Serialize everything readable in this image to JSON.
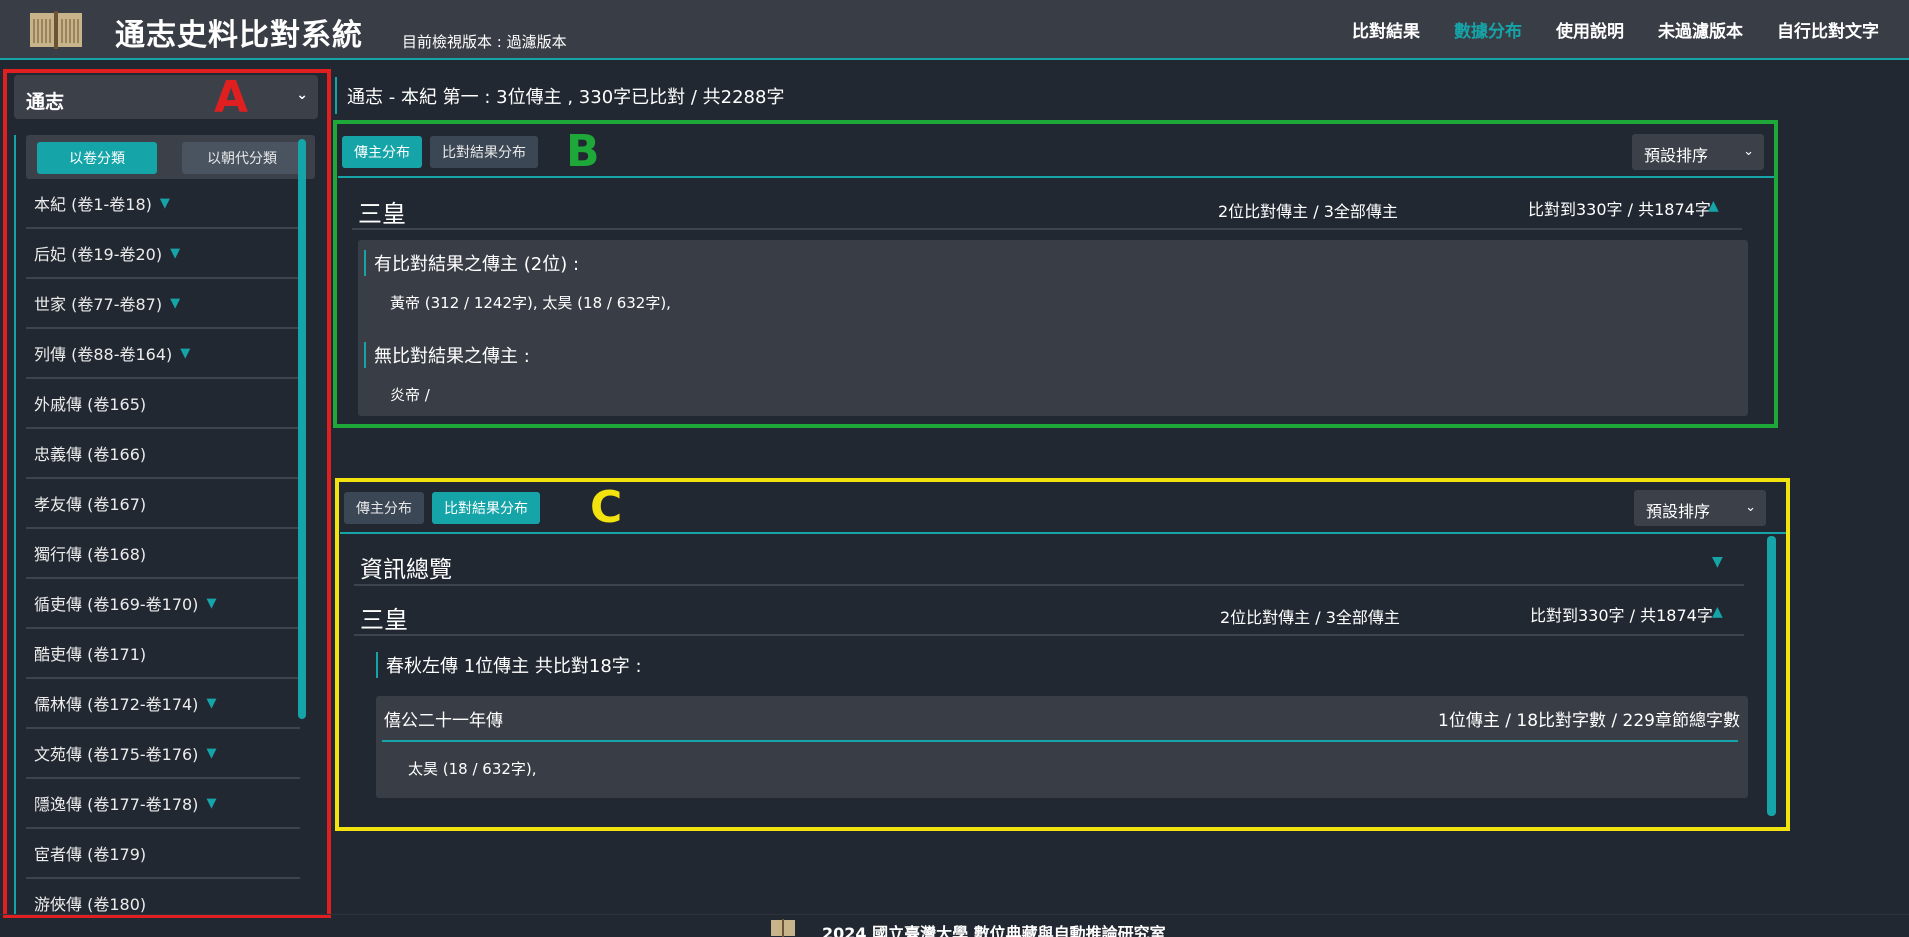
{
  "header": {
    "title": "通志史料比對系統",
    "version_label": "目前檢視版本 : 過濾版本",
    "nav": [
      {
        "label": "比對結果",
        "active": false
      },
      {
        "label": "數據分布",
        "active": true
      },
      {
        "label": "使用說明",
        "active": false
      },
      {
        "label": "未過濾版本",
        "active": false
      },
      {
        "label": "自行比對文字",
        "active": false
      }
    ]
  },
  "sidebar": {
    "book_select": "通志",
    "tabs": [
      {
        "label": "以卷分類",
        "active": true
      },
      {
        "label": "以朝代分類",
        "active": false
      }
    ],
    "chapters": [
      {
        "label": "本紀 (卷1-卷18)",
        "expandable": true
      },
      {
        "label": "后妃 (卷19-卷20)",
        "expandable": true
      },
      {
        "label": "世家 (卷77-卷87)",
        "expandable": true
      },
      {
        "label": "列傳 (卷88-卷164)",
        "expandable": true
      },
      {
        "label": "外戚傳 (卷165)",
        "expandable": false
      },
      {
        "label": "忠義傳 (卷166)",
        "expandable": false
      },
      {
        "label": "孝友傳 (卷167)",
        "expandable": false
      },
      {
        "label": "獨行傳 (卷168)",
        "expandable": false
      },
      {
        "label": "循吏傳 (卷169-卷170)",
        "expandable": true
      },
      {
        "label": "酷吏傳 (卷171)",
        "expandable": false
      },
      {
        "label": "儒林傳 (卷172-卷174)",
        "expandable": true
      },
      {
        "label": "文苑傳 (卷175-卷176)",
        "expandable": true
      },
      {
        "label": "隱逸傳 (卷177-卷178)",
        "expandable": true
      },
      {
        "label": "宦者傳 (卷179)",
        "expandable": false
      },
      {
        "label": "游俠傳 (卷180)",
        "expandable": false
      }
    ]
  },
  "breadcrumb": "通志 - 本紀 第一 :   3位傳主 , 330字已比對 / 共2288字",
  "panel_b": {
    "btn_subject": "傳主分布",
    "btn_result": "比對結果分布",
    "sort": "預設排序",
    "group_title": "三皇",
    "group_count": "2位比對傳主 / 3全部傳主",
    "group_stats": "比對到330字 / 共1874字",
    "matched_head": "有比對結果之傳主 (2位) :",
    "matched_list": "黃帝 (312 / 1242字),    太昊 (18 / 632字),",
    "unmatched_head": "無比對結果之傳主 :",
    "unmatched_list": "炎帝 /"
  },
  "panel_c": {
    "btn_subject": "傳主分布",
    "btn_result": "比對結果分布",
    "sort": "預設排序",
    "overview_title": "資訊總覽",
    "group_title": "三皇",
    "group_count": "2位比對傳主 / 3全部傳主",
    "group_stats": "比對到330字 / 共1874字",
    "source_head": "春秋左傳    1位傳主 共比對18字 :",
    "section_title": "僖公二十一年傳",
    "section_stats": "1位傳主 / 18比對字數 / 229章節總字數",
    "section_names": "太昊 (18 / 632字),"
  },
  "annotations": [
    {
      "label": "A",
      "color": "#e02020"
    },
    {
      "label": "B",
      "color": "#1fa83a"
    },
    {
      "label": "C",
      "color": "#f2e30f"
    }
  ],
  "footer": {
    "text": "2024 國立臺灣大學 數位典藏與自動推論研究室"
  },
  "colors": {
    "accent": "#15a4a8",
    "background": "#222831",
    "surface": "#393e46"
  }
}
